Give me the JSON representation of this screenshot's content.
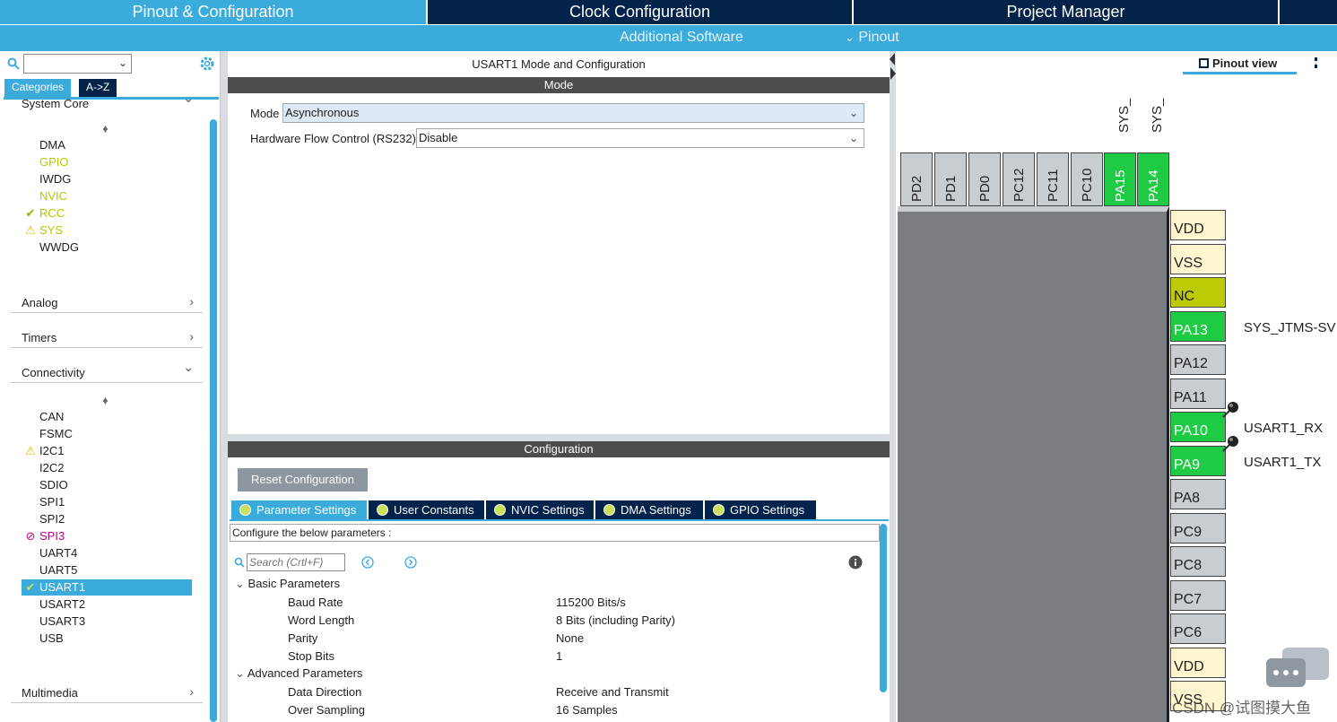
{
  "top_tabs": [
    {
      "label": "Pinout & Configuration",
      "active": true
    },
    {
      "label": "Clock Configuration",
      "active": false
    },
    {
      "label": "Project Manager",
      "active": false
    }
  ],
  "sub_bar": {
    "additional_software": "Additional Software",
    "pinout": "Pinout"
  },
  "left": {
    "search_placeholder": "",
    "tabs": {
      "categories": "Categories",
      "atoz": "A->Z"
    },
    "system_core": {
      "label": "System Core",
      "items": [
        {
          "label": "DMA",
          "state": "none"
        },
        {
          "label": "GPIO",
          "state": "ok"
        },
        {
          "label": "IWDG",
          "state": "none"
        },
        {
          "label": "NVIC",
          "state": "ok"
        },
        {
          "label": "RCC",
          "state": "check"
        },
        {
          "label": "SYS",
          "state": "warn"
        },
        {
          "label": "WWDG",
          "state": "none"
        }
      ]
    },
    "analog": "Analog",
    "timers": "Timers",
    "connectivity": {
      "label": "Connectivity",
      "items": [
        {
          "label": "CAN",
          "state": "none"
        },
        {
          "label": "FSMC",
          "state": "none"
        },
        {
          "label": "I2C1",
          "state": "warn"
        },
        {
          "label": "I2C2",
          "state": "none"
        },
        {
          "label": "SDIO",
          "state": "none"
        },
        {
          "label": "SPI1",
          "state": "none"
        },
        {
          "label": "SPI2",
          "state": "none"
        },
        {
          "label": "SPI3",
          "state": "blocked"
        },
        {
          "label": "UART4",
          "state": "none"
        },
        {
          "label": "UART5",
          "state": "none"
        },
        {
          "label": "USART1",
          "state": "selected"
        },
        {
          "label": "USART2",
          "state": "none"
        },
        {
          "label": "USART3",
          "state": "none"
        },
        {
          "label": "USB",
          "state": "none"
        }
      ]
    },
    "multimedia": "Multimedia"
  },
  "middle": {
    "title": "USART1 Mode and Configuration",
    "mode_bar": "Mode",
    "mode_label": "Mode",
    "mode_value": "Asynchronous",
    "flow_label": "Hardware Flow Control (RS232)",
    "flow_value": "Disable",
    "config_bar": "Configuration",
    "reset_button": "Reset Configuration",
    "tabs": [
      "Parameter Settings",
      "User Constants",
      "NVIC Settings",
      "DMA Settings",
      "GPIO Settings"
    ],
    "configure_text": "Configure the below parameters :",
    "search_placeholder": "Search (Crtl+F)",
    "groups": {
      "basic": "Basic Parameters",
      "advanced": "Advanced Parameters"
    },
    "params": [
      {
        "name": "Baud Rate",
        "value": "115200 Bits/s"
      },
      {
        "name": "Word Length",
        "value": "8 Bits (including Parity)"
      },
      {
        "name": "Parity",
        "value": "None"
      },
      {
        "name": "Stop Bits",
        "value": "1"
      },
      {
        "name": "Data Direction",
        "value": "Receive and Transmit"
      },
      {
        "name": "Over Sampling",
        "value": "16 Samples"
      }
    ]
  },
  "right": {
    "pinout_view": "Pinout view",
    "top_labels": [
      "SYS_",
      "SYS_"
    ],
    "top_pins": [
      {
        "label": "PD2",
        "state": "gray"
      },
      {
        "label": "PD1",
        "state": "gray"
      },
      {
        "label": "PD0",
        "state": "gray"
      },
      {
        "label": "PC12",
        "state": "gray"
      },
      {
        "label": "PC11",
        "state": "gray"
      },
      {
        "label": "PC10",
        "state": "gray"
      },
      {
        "label": "PA15",
        "state": "green"
      },
      {
        "label": "PA14",
        "state": "green"
      }
    ],
    "side_pins": [
      {
        "label": "VDD",
        "state": "pow",
        "signal": ""
      },
      {
        "label": "VSS",
        "state": "pow",
        "signal": ""
      },
      {
        "label": "NC",
        "state": "nc",
        "signal": ""
      },
      {
        "label": "PA13",
        "state": "green",
        "signal": "SYS_JTMS-SV"
      },
      {
        "label": "PA12",
        "state": "gray",
        "signal": ""
      },
      {
        "label": "PA11",
        "state": "gray",
        "signal": ""
      },
      {
        "label": "PA10",
        "state": "green",
        "signal": "USART1_RX"
      },
      {
        "label": "PA9",
        "state": "green",
        "signal": "USART1_TX"
      },
      {
        "label": "PA8",
        "state": "gray",
        "signal": ""
      },
      {
        "label": "PC9",
        "state": "gray",
        "signal": ""
      },
      {
        "label": "PC8",
        "state": "gray",
        "signal": ""
      },
      {
        "label": "PC7",
        "state": "gray",
        "signal": ""
      },
      {
        "label": "PC6",
        "state": "gray",
        "signal": ""
      },
      {
        "label": "VDD",
        "state": "pow",
        "signal": ""
      },
      {
        "label": "VSS",
        "state": "pow",
        "signal": ""
      }
    ],
    "watermark": "CSDN @试图摸大鱼"
  },
  "colors": {
    "accent": "#3babdc",
    "dark_tab": "#03234b",
    "pin_green": "#1fcb44",
    "pin_gray": "#c8cdd2",
    "pin_power": "#fff5cf",
    "pin_nc": "#bccb06",
    "ok_text": "#b7c800",
    "blocked": "#c6007e"
  }
}
